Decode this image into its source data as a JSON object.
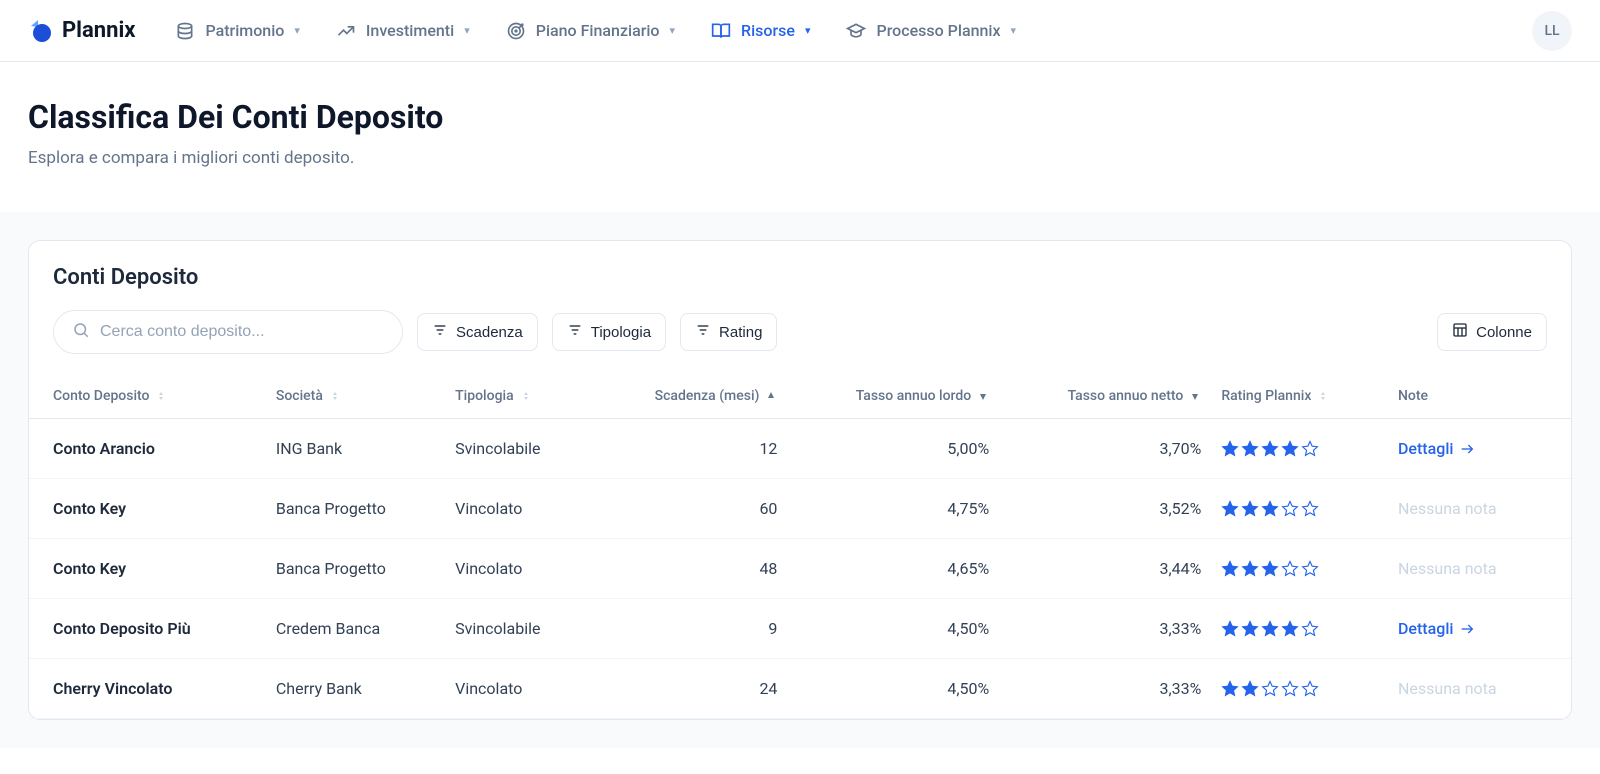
{
  "brand": "Plannix",
  "nav": [
    {
      "label": "Patrimonio",
      "icon": "layers"
    },
    {
      "label": "Investimenti",
      "icon": "trending"
    },
    {
      "label": "Piano Finanziario",
      "icon": "target"
    },
    {
      "label": "Risorse",
      "icon": "book",
      "active": true
    },
    {
      "label": "Processo Plannix",
      "icon": "grad"
    }
  ],
  "avatar": "LL",
  "page": {
    "title": "Classifica Dei Conti Deposito",
    "subtitle": "Esplora e compara i migliori conti deposito."
  },
  "card": {
    "title": "Conti Deposito",
    "search_placeholder": "Cerca conto deposito...",
    "filters": [
      "Scadenza",
      "Tipologia",
      "Rating"
    ],
    "columns_btn": "Colonne",
    "headers": {
      "name": "Conto Deposito",
      "company": "Società",
      "type": "Tipologia",
      "maturity": "Scadenza (mesi)",
      "gross": "Tasso annuo lordo",
      "net": "Tasso annuo netto",
      "rating": "Rating Plannix",
      "note": "Note"
    },
    "note_link": "Dettagli",
    "note_empty": "Nessuna nota",
    "rows": [
      {
        "name": "Conto Arancio",
        "company": "ING Bank",
        "type": "Svincolabile",
        "maturity": "12",
        "gross": "5,00%",
        "net": "3,70%",
        "rating": 4,
        "hasNote": true
      },
      {
        "name": "Conto Key",
        "company": "Banca Progetto",
        "type": "Vincolato",
        "maturity": "60",
        "gross": "4,75%",
        "net": "3,52%",
        "rating": 3,
        "hasNote": false
      },
      {
        "name": "Conto Key",
        "company": "Banca Progetto",
        "type": "Vincolato",
        "maturity": "48",
        "gross": "4,65%",
        "net": "3,44%",
        "rating": 3,
        "hasNote": false
      },
      {
        "name": "Conto Deposito Più",
        "company": "Credem Banca",
        "type": "Svincolabile",
        "maturity": "9",
        "gross": "4,50%",
        "net": "3,33%",
        "rating": 4,
        "hasNote": true
      },
      {
        "name": "Cherry Vincolato",
        "company": "Cherry Bank",
        "type": "Vincolato",
        "maturity": "24",
        "gross": "4,50%",
        "net": "3,33%",
        "rating": 2,
        "hasNote": false
      }
    ]
  }
}
